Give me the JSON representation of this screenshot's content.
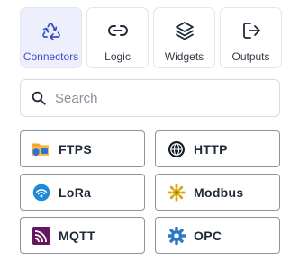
{
  "tabs": [
    {
      "id": "connectors",
      "label": "Connectors",
      "icon": "recycle-icon",
      "active": true
    },
    {
      "id": "logic",
      "label": "Logic",
      "icon": "link-icon",
      "active": false
    },
    {
      "id": "widgets",
      "label": "Widgets",
      "icon": "layers-icon",
      "active": false
    },
    {
      "id": "outputs",
      "label": "Outputs",
      "icon": "logout-icon",
      "active": false
    }
  ],
  "search": {
    "placeholder": "Search",
    "value": ""
  },
  "connectors": [
    {
      "label": "FTPS",
      "icon": "ftps-folder-icon"
    },
    {
      "label": "HTTP",
      "icon": "globe-icon"
    },
    {
      "label": "LoRa",
      "icon": "wireless-icon"
    },
    {
      "label": "Modbus",
      "icon": "modbus-gear-icon"
    },
    {
      "label": "MQTT",
      "icon": "mqtt-icon"
    },
    {
      "label": "OPC",
      "icon": "opc-gear-icon"
    }
  ],
  "colors": {
    "accent": "#3b4fc4",
    "active_tab_bg": "#edf0fc",
    "card_border": "#8e949c"
  }
}
